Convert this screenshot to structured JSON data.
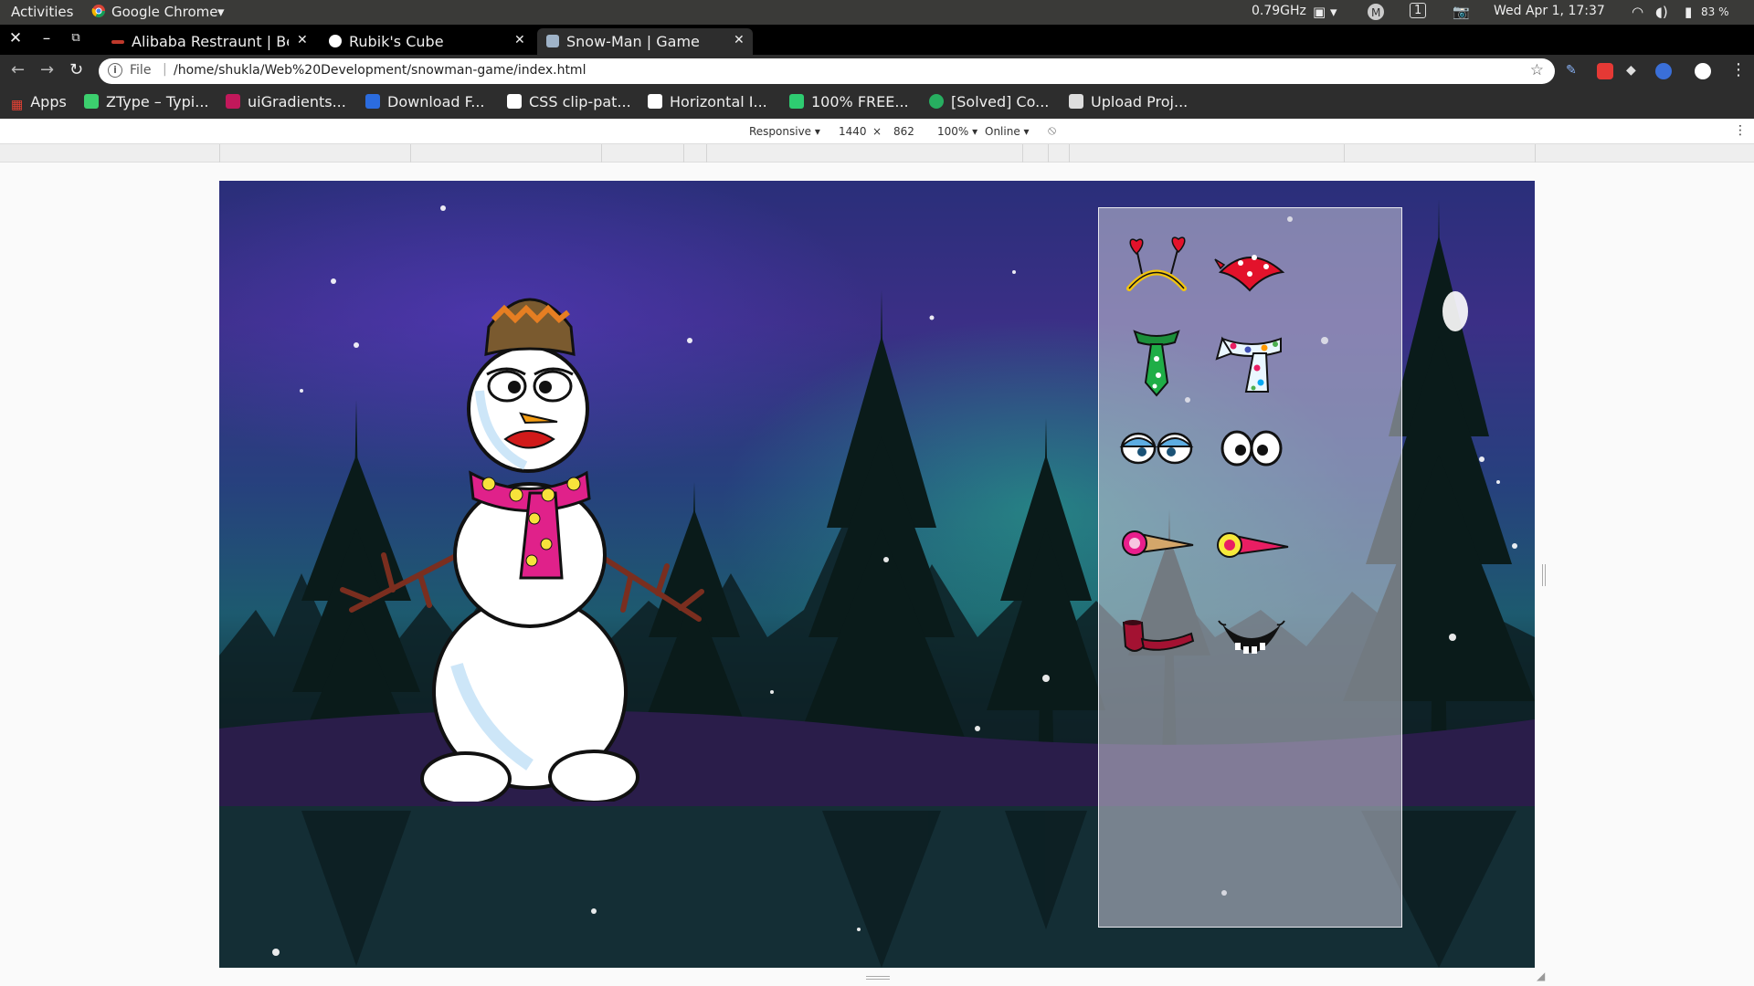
{
  "system_bar": {
    "activities": "Activities",
    "app_name": "Google Chrome",
    "cpu": "0.79GHz",
    "workspace": "1",
    "datetime": "Wed Apr  1, 17:37",
    "battery": "83 %"
  },
  "tabs": [
    {
      "title": "Alibaba Restraunt | Be",
      "active": false
    },
    {
      "title": "Rubik's Cube",
      "active": false
    },
    {
      "title": "Snow-Man | Game",
      "active": true
    }
  ],
  "address_bar": {
    "scheme_label": "File",
    "url": "/home/shukla/Web%20Development/snowman-game/index.html"
  },
  "bookmarks": [
    {
      "label": "Apps",
      "color": "#e94235"
    },
    {
      "label": "ZType – Typi...",
      "color": "#3ccf6e"
    },
    {
      "label": "uiGradients...",
      "color": "#c2185b"
    },
    {
      "label": "Download F...",
      "color": "#2b6cdf"
    },
    {
      "label": "CSS clip-pat...",
      "color": "#ffffff"
    },
    {
      "label": "Horizontal I...",
      "color": "#ffffff"
    },
    {
      "label": "100% FREE...",
      "color": "#2ecc71"
    },
    {
      "label": "[Solved] Co...",
      "color": "#27ae60"
    },
    {
      "label": "Upload Proj...",
      "color": "#dddddd"
    }
  ],
  "device_toolbar": {
    "device": "Responsive",
    "width": "1440",
    "times": "×",
    "height": "862",
    "zoom": "100%",
    "network": "Online"
  },
  "game": {
    "accessories": [
      {
        "name": "heart-headband",
        "col": 0,
        "row": 0
      },
      {
        "name": "red-bandana",
        "col": 1,
        "row": 0
      },
      {
        "name": "green-tie",
        "col": 0,
        "row": 1
      },
      {
        "name": "polka-scarf",
        "col": 1,
        "row": 1
      },
      {
        "name": "sleepy-eyes",
        "col": 0,
        "row": 2
      },
      {
        "name": "round-eyes",
        "col": 1,
        "row": 2
      },
      {
        "name": "cone-nose-tan",
        "col": 0,
        "row": 3
      },
      {
        "name": "cone-nose-pink",
        "col": 1,
        "row": 3
      },
      {
        "name": "pipe",
        "col": 0,
        "row": 4
      },
      {
        "name": "grin-mouth",
        "col": 1,
        "row": 4
      }
    ],
    "colors": {
      "hat": "#7a5a2f",
      "hat_band": "#e67e22",
      "scarf": "#e0218a",
      "lips": "#d11a1a",
      "nose": "#f39c12"
    }
  }
}
